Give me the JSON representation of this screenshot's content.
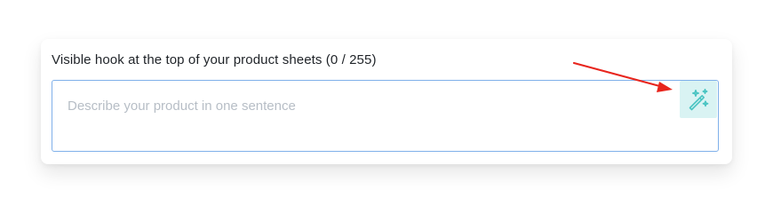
{
  "field": {
    "label": "Visible hook at the top of your product sheets (0 / 255)",
    "value": "",
    "placeholder": "Describe your product in one sentence"
  },
  "magic_button": {
    "icon": "magic-wand-icon",
    "background": "#d9f3f3",
    "icon_color": "#49c4c2"
  },
  "annotation": {
    "arrow_color": "#e8251d"
  },
  "colors": {
    "input_border": "#7fb0ea",
    "label_text": "#1f2328",
    "placeholder_text": "#b7bec6"
  }
}
